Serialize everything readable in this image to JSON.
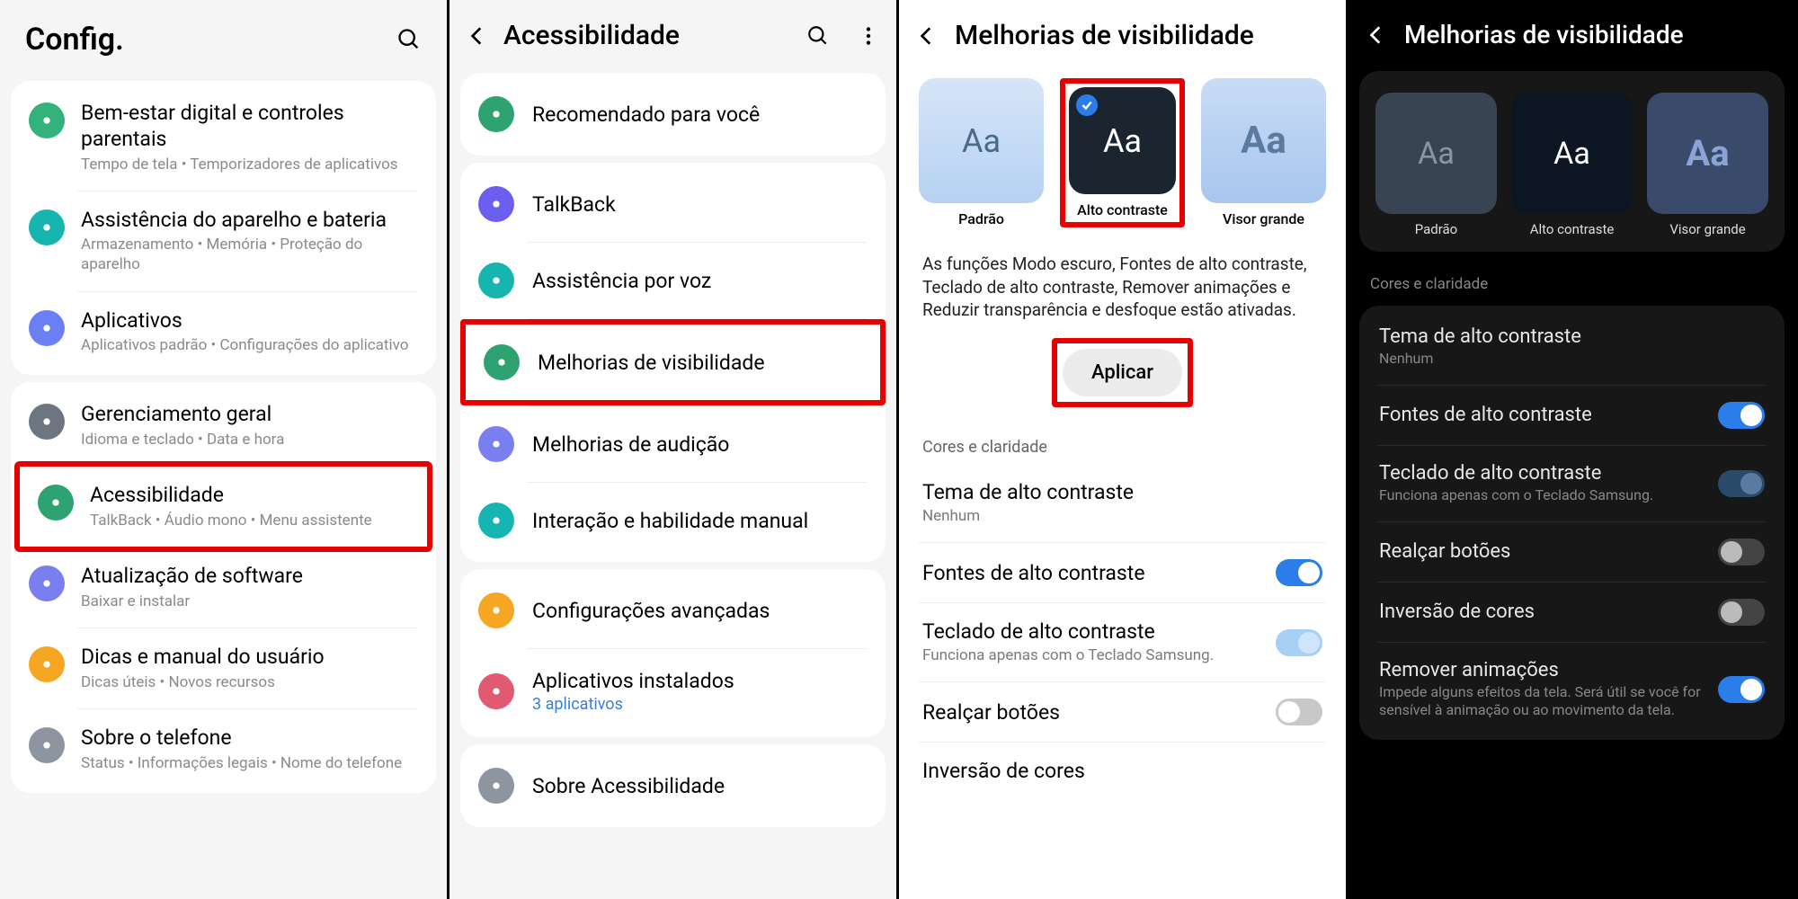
{
  "p1": {
    "title": "Config.",
    "groups": [
      {
        "rows": [
          {
            "icon": "wellbeing",
            "color": "#34b27b",
            "title": "Bem-estar digital e controles parentais",
            "sub": "Tempo de tela  •  Temporizadores de aplicativos"
          },
          {
            "icon": "battery",
            "color": "#17b5b0",
            "title": "Assistência do aparelho e bateria",
            "sub": "Armazenamento  •  Memória  •  Proteção do aparelho"
          },
          {
            "icon": "apps",
            "color": "#6b7ff5",
            "title": "Aplicativos",
            "sub": "Aplicativos padrão  •  Configurações do aplicativo"
          }
        ]
      },
      {
        "rows": [
          {
            "icon": "general",
            "color": "#6d7680",
            "title": "Gerenciamento geral",
            "sub": "Idioma e teclado  •  Data e hora"
          },
          {
            "icon": "accessibility",
            "color": "#2fa36f",
            "title": "Acessibilidade",
            "sub": "TalkBack  •  Áudio mono  •  Menu assistente",
            "highlight": true
          },
          {
            "icon": "update",
            "color": "#7a7ff0",
            "title": "Atualização de software",
            "sub": "Baixar e instalar"
          },
          {
            "icon": "tips",
            "color": "#f5a623",
            "title": "Dicas e manual do usuário",
            "sub": "Dicas úteis  •  Novos recursos"
          },
          {
            "icon": "about",
            "color": "#8d95a0",
            "title": "Sobre o telefone",
            "sub": "Status  •  Informações legais  •  Nome do telefone"
          }
        ]
      }
    ]
  },
  "p2": {
    "title": "Acessibilidade",
    "groups": [
      {
        "rows": [
          {
            "icon": "recommend",
            "color": "#2fa36f",
            "title": "Recomendado para você"
          }
        ]
      },
      {
        "rows": [
          {
            "icon": "talkback",
            "color": "#6b5ff0",
            "title": "TalkBack"
          },
          {
            "icon": "voice",
            "color": "#17b5b0",
            "title": "Assistência por voz"
          },
          {
            "icon": "visibility",
            "color": "#2fa36f",
            "title": "Melhorias de visibilidade",
            "highlight": true
          },
          {
            "icon": "hearing",
            "color": "#7a7ff0",
            "title": "Melhorias de audição"
          },
          {
            "icon": "interaction",
            "color": "#17b5b0",
            "title": "Interação e habilidade manual"
          }
        ]
      },
      {
        "rows": [
          {
            "icon": "advanced",
            "color": "#f5a623",
            "title": "Configurações avançadas"
          },
          {
            "icon": "installed",
            "color": "#e05a72",
            "title": "Aplicativos instalados",
            "sub": "3 aplicativos"
          }
        ]
      },
      {
        "rows": [
          {
            "icon": "about-a11y",
            "color": "#8d95a0",
            "title": "Sobre Acessibilidade"
          }
        ]
      }
    ]
  },
  "p3": {
    "title": "Melhorias de visibilidade",
    "modes": [
      {
        "label": "Padrão",
        "glyph": "Aa"
      },
      {
        "label": "Alto contraste",
        "glyph": "Aa",
        "selected": true,
        "highlight": true
      },
      {
        "label": "Visor grande",
        "glyph": "Aa"
      }
    ],
    "desc": "As funções Modo escuro, Fontes de alto contraste, Teclado de alto contraste, Remover animações e Reduzir transparência e desfoque estão ativadas.",
    "apply": "Aplicar",
    "section": "Cores e claridade",
    "rows": [
      {
        "title": "Tema de alto contraste",
        "sub": "Nenhum"
      },
      {
        "title": "Fontes de alto contraste",
        "toggle": "on"
      },
      {
        "title": "Teclado de alto contraste",
        "sub": "Funciona apenas com o Teclado Samsung.",
        "toggle": "on-light"
      },
      {
        "title": "Realçar botões",
        "toggle": "off"
      },
      {
        "title": "Inversão de cores"
      }
    ]
  },
  "p4": {
    "title": "Melhorias de visibilidade",
    "modes": [
      {
        "label": "Padrão",
        "glyph": "Aa"
      },
      {
        "label": "Alto contraste",
        "glyph": "Aa"
      },
      {
        "label": "Visor grande",
        "glyph": "Aa"
      }
    ],
    "section": "Cores e claridade",
    "rows": [
      {
        "title": "Tema de alto contraste",
        "sub": "Nenhum"
      },
      {
        "title": "Fontes de alto contraste",
        "toggle": "on"
      },
      {
        "title": "Teclado de alto contraste",
        "sub": "Funciona apenas com o Teclado Samsung.",
        "toggle": "semi"
      },
      {
        "title": "Realçar botões",
        "toggle": "off"
      },
      {
        "title": "Inversão de cores",
        "toggle": "off"
      },
      {
        "title": "Remover animações",
        "sub": "Impede alguns efeitos da tela. Será útil se você for sensível à animação ou ao movimento da tela.",
        "toggle": "on"
      }
    ]
  }
}
